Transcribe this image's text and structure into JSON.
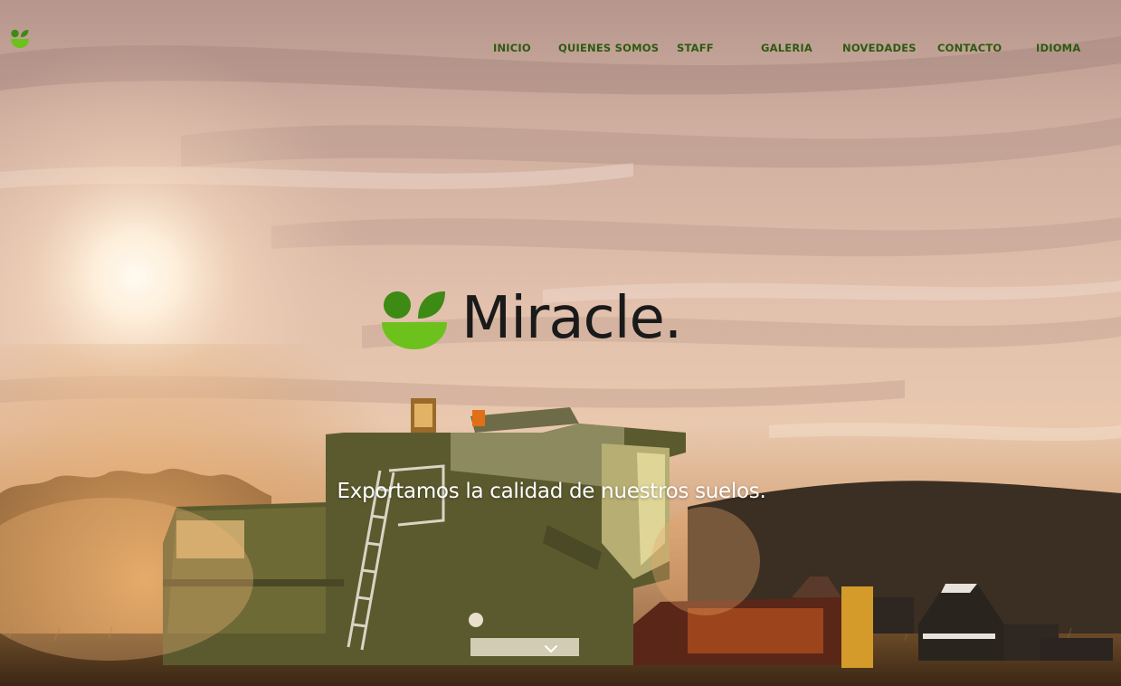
{
  "colors": {
    "brand_green": "#6cc11c",
    "dark_green": "#3d8a14",
    "nav_text": "#2e5a10",
    "sky_top": "#c9a79c",
    "sky_mid": "#e8c9b8",
    "sun": "#fff6e6",
    "wordmark": "#1a1a1a"
  },
  "nav": {
    "items": [
      {
        "label": "INICIO"
      },
      {
        "label": "QUIENES SOMOS"
      },
      {
        "label": "STAFF"
      },
      {
        "label": "GALERIA"
      },
      {
        "label": "NOVEDADES"
      },
      {
        "label": "CONTACTO"
      },
      {
        "label": "IDIOMA"
      }
    ]
  },
  "hero": {
    "brand_name": "Miracle.",
    "tagline": "Exportamos la calidad de nuestros suelos."
  },
  "icons": {
    "corner_logo": "miracle-logo-icon",
    "brand_mark": "miracle-logo-icon",
    "scroll": "chevron-down-icon"
  }
}
